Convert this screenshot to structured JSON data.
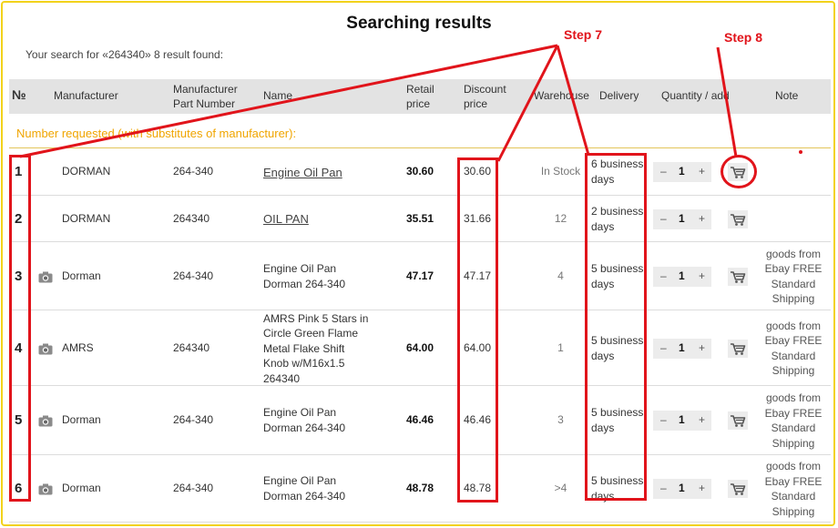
{
  "header": {
    "title": "Searching results",
    "subtitle": "Your search for «264340» 8 result found:"
  },
  "columns": {
    "no": "№",
    "manufacturer": "Manufacturer",
    "part_number": [
      "Manufacturer",
      "Part Number"
    ],
    "name": "Name",
    "retail_price": [
      "Retail",
      "price"
    ],
    "discount_price": [
      "Discount",
      "price"
    ],
    "warehouse": "Warehouse",
    "delivery": "Delivery",
    "quantity": "Quantity / add",
    "note": "Note"
  },
  "section_label": "Number requested (with substitutes of manufacturer):",
  "rows": [
    {
      "no": "1",
      "manufacturer": "DORMAN",
      "part": "264-340",
      "name": [
        "Engine Oil Pan"
      ],
      "name_link": true,
      "retail": "30.60",
      "discount": "30.60",
      "warehouse": "In Stock",
      "delivery": [
        "6 business",
        "days"
      ],
      "qty": "1",
      "note": [],
      "camera": false
    },
    {
      "no": "2",
      "manufacturer": "DORMAN",
      "part": "264340",
      "name": [
        "OIL PAN"
      ],
      "name_link": true,
      "retail": "35.51",
      "discount": "31.66",
      "warehouse": "12",
      "delivery": [
        "2 business",
        "days"
      ],
      "qty": "1",
      "note": [],
      "camera": false
    },
    {
      "no": "3",
      "manufacturer": "Dorman",
      "part": "264-340",
      "name": [
        "Engine Oil Pan",
        "Dorman 264-340"
      ],
      "name_link": false,
      "retail": "47.17",
      "discount": "47.17",
      "warehouse": "4",
      "delivery": [
        "5 business",
        "days"
      ],
      "qty": "1",
      "note": [
        "goods from",
        "Ebay FREE",
        "Standard",
        "Shipping"
      ],
      "camera": true
    },
    {
      "no": "4",
      "manufacturer": "AMRS",
      "part": "264340",
      "name": [
        "AMRS Pink 5 Stars in",
        "Circle Green Flame",
        "Metal Flake Shift",
        "Knob w/M16x1.5",
        "264340"
      ],
      "name_link": false,
      "retail": "64.00",
      "discount": "64.00",
      "warehouse": "1",
      "delivery": [
        "5 business",
        "days"
      ],
      "qty": "1",
      "note": [
        "goods from",
        "Ebay FREE",
        "Standard",
        "Shipping"
      ],
      "camera": true
    },
    {
      "no": "5",
      "manufacturer": "Dorman",
      "part": "264-340",
      "name": [
        "Engine Oil Pan",
        "Dorman 264-340"
      ],
      "name_link": false,
      "retail": "46.46",
      "discount": "46.46",
      "warehouse": "3",
      "delivery": [
        "5 business",
        "days"
      ],
      "qty": "1",
      "note": [
        "goods from",
        "Ebay FREE",
        "Standard",
        "Shipping"
      ],
      "camera": true
    },
    {
      "no": "6",
      "manufacturer": "Dorman",
      "part": "264-340",
      "name": [
        "Engine Oil Pan",
        "Dorman 264-340"
      ],
      "name_link": false,
      "retail": "48.78",
      "discount": "48.78",
      "warehouse": ">4",
      "delivery": [
        "5 business",
        "days"
      ],
      "qty": "1",
      "note": [
        "goods from",
        "Ebay FREE",
        "Standard",
        "Shipping"
      ],
      "camera": true
    }
  ],
  "qty_controls": {
    "minus": "–",
    "plus": "+"
  },
  "annotations": {
    "step7": "Step 7",
    "step8": "Step 8",
    "color": "#e1141b"
  },
  "colors": {
    "accent": "#f2d21b",
    "section": "#f0a500",
    "header_bg": "#e3e3e3"
  },
  "icons": {
    "camera": "camera-icon",
    "cart": "shopping-cart-icon"
  }
}
